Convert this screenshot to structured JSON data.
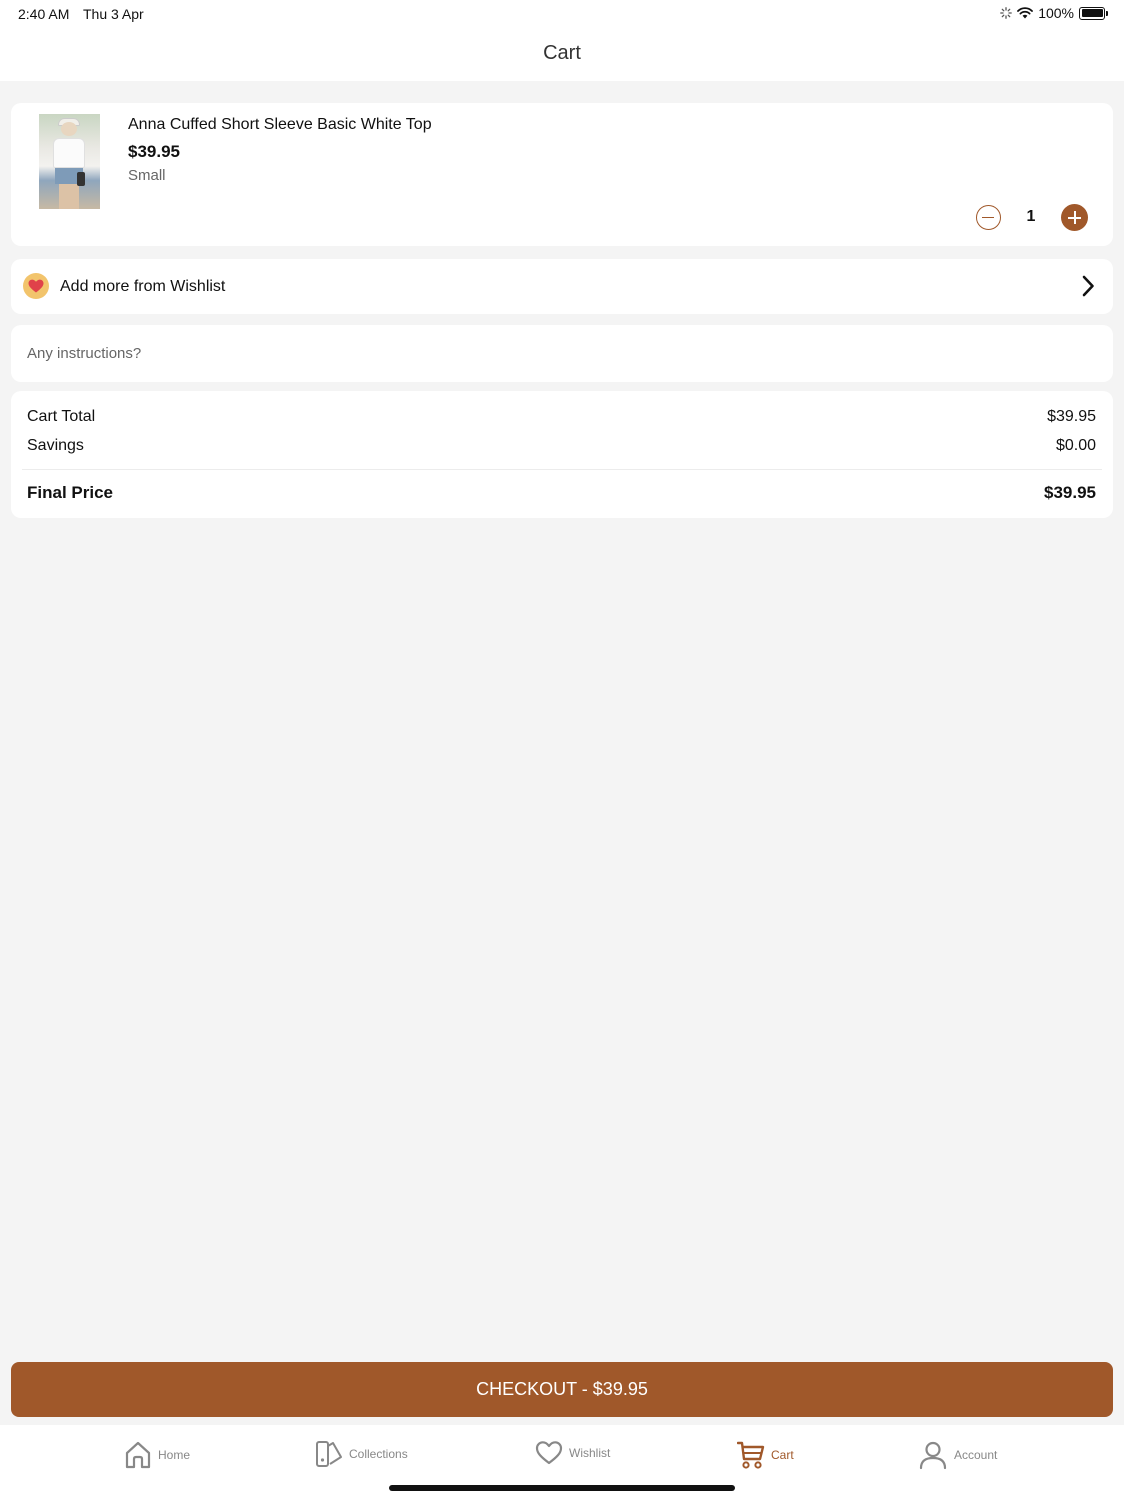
{
  "status_bar": {
    "time": "2:40 AM",
    "date": "Thu 3 Apr",
    "battery": "100%"
  },
  "header": {
    "title": "Cart"
  },
  "cart": {
    "items": [
      {
        "name": "Anna Cuffed Short Sleeve Basic White Top",
        "price": "$39.95",
        "variant": "Small",
        "quantity": "1"
      }
    ]
  },
  "wishlist": {
    "label": "Add more from Wishlist",
    "icon": "heart-icon"
  },
  "instructions": {
    "placeholder": "Any instructions?",
    "value": ""
  },
  "totals": {
    "cart_total_label": "Cart Total",
    "cart_total_value": "$39.95",
    "savings_label": "Savings",
    "savings_value": "$0.00",
    "final_label": "Final Price",
    "final_value": "$39.95"
  },
  "checkout": {
    "label": "CHECKOUT - $39.95"
  },
  "tabs": [
    {
      "label": "Home",
      "icon": "home-icon",
      "active": false
    },
    {
      "label": "Collections",
      "icon": "collections-icon",
      "active": false
    },
    {
      "label": "Wishlist",
      "icon": "heart-icon",
      "active": false
    },
    {
      "label": "Cart",
      "icon": "cart-icon",
      "active": true
    },
    {
      "label": "Account",
      "icon": "user-icon",
      "active": false
    }
  ],
  "colors": {
    "accent": "#a0582a",
    "background": "#f4f4f4",
    "card": "#ffffff",
    "wishlist_badge": "#f2c46c",
    "heart": "#e0424a"
  }
}
